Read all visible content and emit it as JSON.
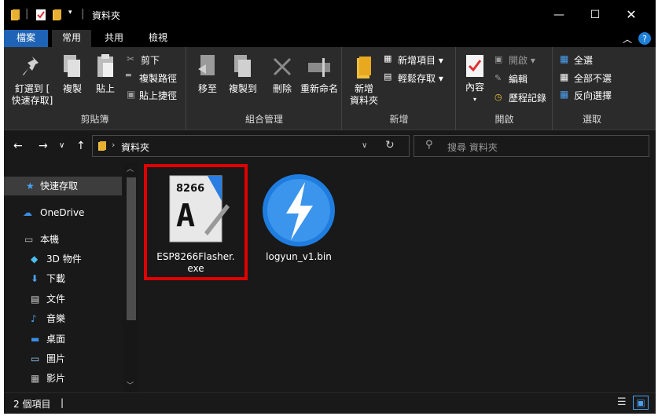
{
  "window": {
    "title": "資料夾"
  },
  "menu_tabs": [
    "檔案",
    "常用",
    "共用",
    "檢視"
  ],
  "ribbon": {
    "clipboard": {
      "pin_label_1": "釘選到 [",
      "pin_label_2": "快速存取]",
      "copy": "複製",
      "paste": "貼上",
      "cut": "剪下",
      "copy_path": "複製路徑",
      "paste_shortcut": "貼上捷徑",
      "group": "剪貼簿"
    },
    "organize": {
      "move_to": "移至",
      "copy_to": "複製到",
      "delete": "刪除",
      "rename": "重新命名",
      "group": "組合管理"
    },
    "new": {
      "new_folder_1": "新增",
      "new_folder_2": "資料夾",
      "new_item": "新增項目 ▾",
      "easy_access": "輕鬆存取 ▾",
      "group": "新增"
    },
    "open": {
      "properties": "內容",
      "open": "開啟 ▾",
      "edit": "編輯",
      "history": "歷程記錄",
      "group": "開啟"
    },
    "select": {
      "select_all": "全選",
      "select_none": "全部不選",
      "invert": "反向選擇",
      "group": "選取"
    }
  },
  "address": {
    "path": "資料夾",
    "search_placeholder": "搜尋 資料夾"
  },
  "nav_pane": {
    "items": [
      {
        "label": "快速存取",
        "icon": "star-icon"
      },
      {
        "label": "OneDrive",
        "icon": "cloud-icon"
      },
      {
        "label": "本機",
        "icon": "pc-icon"
      },
      {
        "label": "3D 物件",
        "icon": "cube-icon"
      },
      {
        "label": "下載",
        "icon": "download-icon"
      },
      {
        "label": "文件",
        "icon": "document-icon"
      },
      {
        "label": "音樂",
        "icon": "music-icon"
      },
      {
        "label": "桌面",
        "icon": "desktop-icon"
      },
      {
        "label": "圖片",
        "icon": "pictures-icon"
      },
      {
        "label": "影片",
        "icon": "video-icon"
      }
    ]
  },
  "files": [
    {
      "name_line1": "ESP8266Flasher.",
      "name_line2": "exe",
      "icon_text": "8266",
      "icon_letter": "A"
    },
    {
      "name_line1": "logyun_v1.bin",
      "name_line2": ""
    }
  ],
  "status": {
    "count": "2 個項目",
    "sep": "|"
  },
  "colors": {
    "accent": "#1e63b5",
    "highlight_box": "#e00000",
    "bg": "#191919",
    "ribbon": "#2b2b2b"
  }
}
